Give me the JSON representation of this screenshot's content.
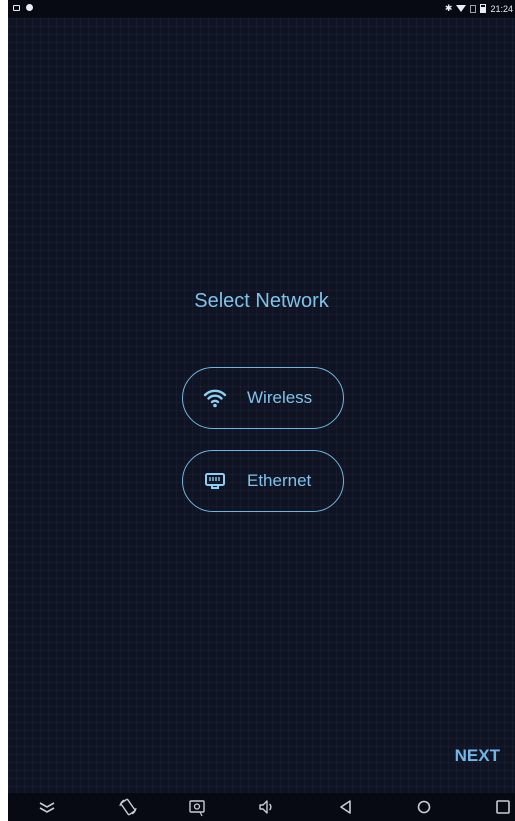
{
  "status_bar": {
    "time": "21:24",
    "left_icons": [
      "notification-icon",
      "circle-icon"
    ],
    "right_icons": [
      "bluetooth-icon",
      "wifi-signal-icon",
      "sim-icon",
      "battery-icon"
    ]
  },
  "screen": {
    "title": "Select Network",
    "options": [
      {
        "label": "Wireless",
        "icon": "wifi-icon"
      },
      {
        "label": "Ethernet",
        "icon": "ethernet-icon"
      }
    ],
    "next_label": "NEXT"
  },
  "nav_bar": {
    "icons": [
      "collapse-icon",
      "rotate-icon",
      "screenshot-icon",
      "volume-icon",
      "back-icon",
      "home-icon",
      "recents-icon"
    ]
  },
  "colors": {
    "background": "#0f1322",
    "accent": "#7ec3ea",
    "bars": "#070a12"
  }
}
